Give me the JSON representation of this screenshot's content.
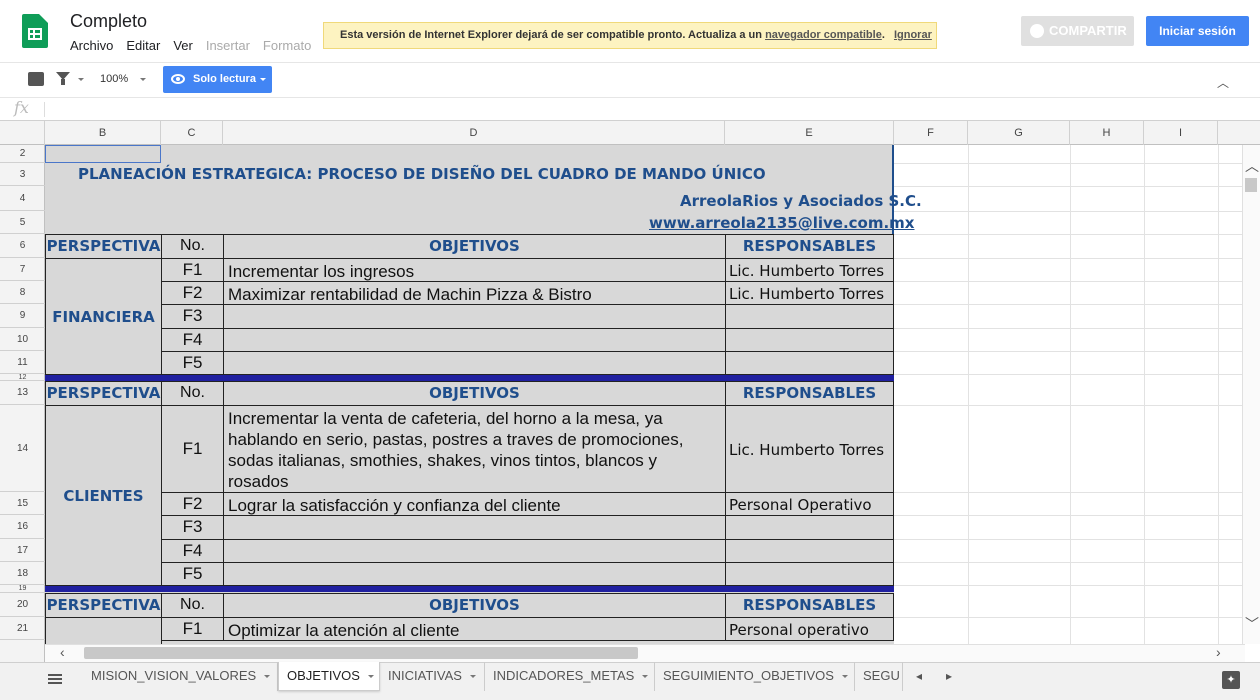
{
  "header": {
    "title": "Completo",
    "menu": [
      "Archivo",
      "Editar",
      "Ver",
      "Insertar",
      "Formato"
    ],
    "banner_text": "Esta versión de Internet Explorer dejará de ser compatible pronto. Actualiza a un",
    "banner_link": "navegador compatible",
    "banner_period": ".",
    "banner_ignore": "Ignorar",
    "share_label": "COMPARTIR",
    "signin_label": "Iniciar sesión"
  },
  "toolbar": {
    "zoom": "100%",
    "mode_label": "Solo lectura"
  },
  "formula_bar": {
    "fx": "fx"
  },
  "columns": [
    "B",
    "C",
    "D",
    "E",
    "F",
    "G",
    "H",
    "I"
  ],
  "rows": [
    "2",
    "3",
    "4",
    "5",
    "6",
    "7",
    "8",
    "9",
    "10",
    "11",
    "12",
    "13",
    "14",
    "15",
    "16",
    "17",
    "18",
    "19",
    "20",
    "21"
  ],
  "sheet": {
    "title": "PLANEACIÓN ESTRATEGICA: PROCESO DE DISEÑO DEL CUADRO DE MANDO ÚNICO",
    "company": "ArreolaRios y Asociados S.C.",
    "website": "www.arreola2135@live.com.mx",
    "headers": {
      "perspective": "PERSPECTIVA",
      "no": "No.",
      "objectives": "OBJETIVOS",
      "responsible": "RESPONSABLES"
    },
    "sections": [
      {
        "perspective": "FINANCIERA",
        "rows": [
          {
            "no": "F1",
            "objective": "Incrementar los ingresos",
            "responsible": "Lic. Humberto Torres"
          },
          {
            "no": "F2",
            "objective": "Maximizar rentabilidad de Machin Pizza & Bistro",
            "responsible": "Lic. Humberto Torres"
          },
          {
            "no": "F3",
            "objective": "",
            "responsible": ""
          },
          {
            "no": "F4",
            "objective": "",
            "responsible": ""
          },
          {
            "no": "F5",
            "objective": "",
            "responsible": ""
          }
        ]
      },
      {
        "perspective": "CLIENTES",
        "rows": [
          {
            "no": "F1",
            "objective": "Incrementar la  venta de cafeteria, del horno a la mesa, ya hablando en serio, pastas, postres a traves de promociones, sodas italianas, smothies, shakes, vinos tintos, blancos y rosados",
            "responsible": "Lic. Humberto Torres"
          },
          {
            "no": "F2",
            "objective": "Lograr la satisfacción y confianza del cliente",
            "responsible": "Personal Operativo"
          },
          {
            "no": "F3",
            "objective": "",
            "responsible": ""
          },
          {
            "no": "F4",
            "objective": "",
            "responsible": ""
          },
          {
            "no": "F5",
            "objective": "",
            "responsible": ""
          }
        ]
      },
      {
        "perspective": "",
        "rows": [
          {
            "no": "F1",
            "objective": "Optimizar la atención al cliente",
            "responsible": "Personal operativo"
          }
        ]
      }
    ]
  },
  "tabs": [
    "MISION_VISION_VALORES",
    "OBJETIVOS",
    "INICIATIVAS",
    "INDICADORES_METAS",
    "SEGUIMIENTO_OBJETIVOS",
    "SEGU"
  ],
  "active_tab": "OBJETIVOS"
}
